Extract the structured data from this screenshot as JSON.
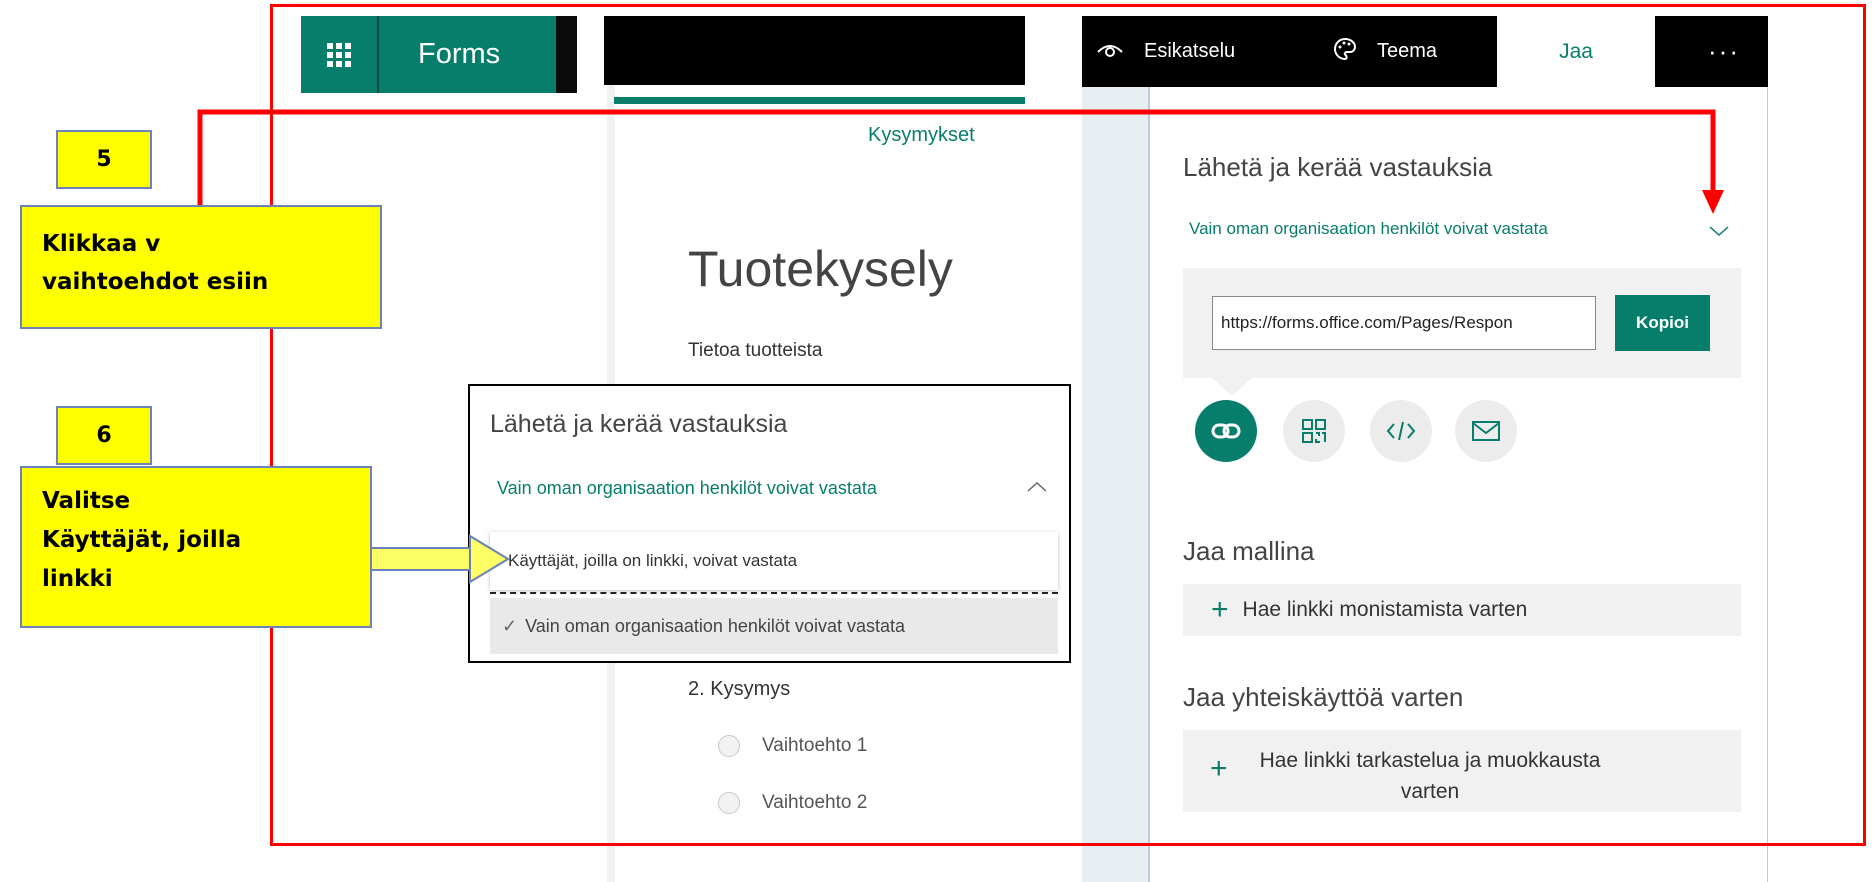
{
  "forms_header": {
    "app_name": "Forms"
  },
  "form": {
    "tab_questions": "Kysymykset",
    "title": "Tuotekysely",
    "description": "Tietoa tuotteista",
    "question2": "2. Kysymys",
    "options": [
      "Vaihtoehto 1",
      "Vaihtoehto 2"
    ]
  },
  "toolbar": {
    "preview": "Esikatselu",
    "theme": "Teema",
    "share": "Jaa",
    "more": "···"
  },
  "share_panel": {
    "heading": "Lähetä ja kerää vastauksia",
    "audience_selected": "Vain oman organisaation henkilöt voivat vastata",
    "link_value": "https://forms.office.com/Pages/Respon",
    "copy_button": "Kopioi",
    "share_as_template": "Jaa mallina",
    "get_duplicate_link": "Hae linkki monistamista varten",
    "share_to_collaborate": "Jaa yhteiskäyttöä varten",
    "get_edit_link_line1": "Hae linkki tarkastelua ja muokkausta",
    "get_edit_link_line2": "varten"
  },
  "dropdown_popover": {
    "heading": "Lähetä ja kerää vastauksia",
    "selected": "Vain oman organisaation henkilöt voivat vastata",
    "option_link": "Käyttäjät, joilla on linkki, voivat vastata",
    "option_org": "Vain oman organisaation henkilöt voivat vastata"
  },
  "annotations": {
    "step5_number": "5",
    "step5_line1": "Klikkaa   v",
    "step5_line2": "vaihtoehdot esiin",
    "step6_number": "6",
    "step6_line1": "Valitse",
    "step6_line2": "Käyttäjät, joilla",
    "step6_line3": "linkki"
  },
  "colors": {
    "brand_green": "#077d6b",
    "annotation_red": "#ff0000",
    "annotation_yellow": "#ffff00"
  },
  "icons": [
    "waffle-icon",
    "eye-icon",
    "palette-icon",
    "link-icon",
    "qr-code-icon",
    "embed-icon",
    "mail-icon",
    "chevron-down-icon",
    "chevron-up-icon",
    "check-icon",
    "plus-icon"
  ]
}
